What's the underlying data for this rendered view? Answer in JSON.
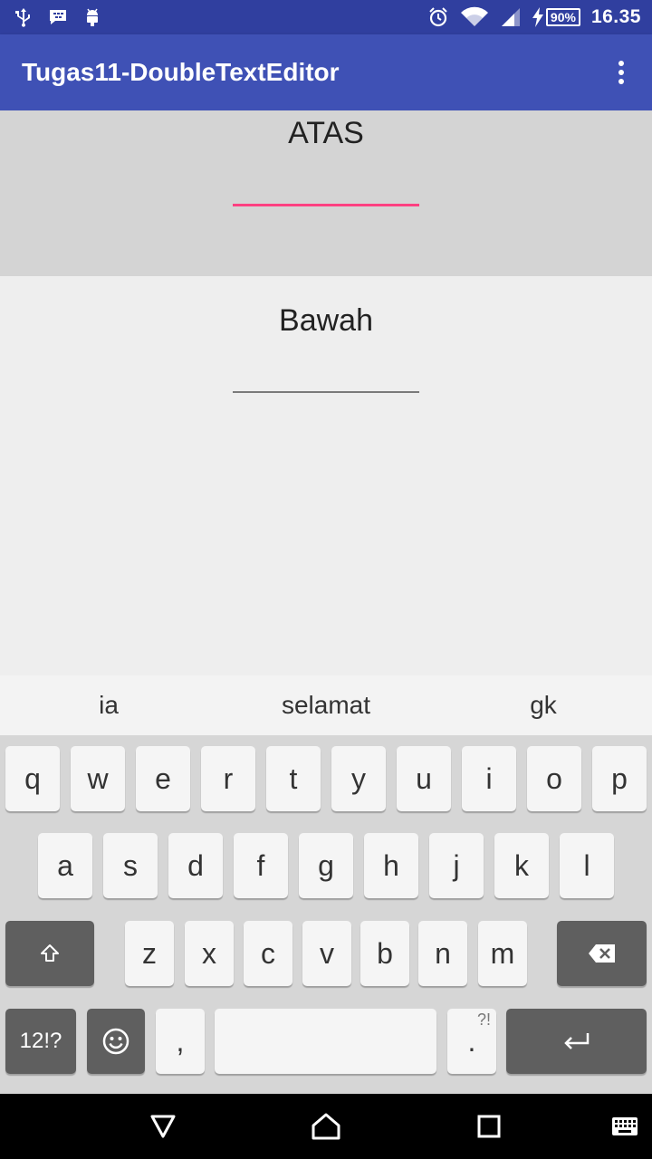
{
  "status_bar": {
    "icons": [
      "usb-icon",
      "bbm-icon",
      "android-debug-icon",
      "alarm-icon",
      "wifi-icon",
      "signal-icon",
      "charging-icon"
    ],
    "battery": "90%",
    "time": "16.35"
  },
  "app_bar": {
    "title": "Tugas11-DoubleTextEditor",
    "overflow_icon": "more-vert-icon"
  },
  "panels": {
    "top": {
      "label": "ATAS",
      "value": "",
      "accent": "#ff4081"
    },
    "bottom": {
      "label": "Bawah",
      "value": ""
    }
  },
  "suggestions": [
    "ia",
    "selamat",
    "gk"
  ],
  "keyboard": {
    "row1": [
      "q",
      "w",
      "e",
      "r",
      "t",
      "y",
      "u",
      "i",
      "o",
      "p"
    ],
    "row2": [
      "a",
      "s",
      "d",
      "f",
      "g",
      "h",
      "j",
      "k",
      "l"
    ],
    "row3": [
      "z",
      "x",
      "c",
      "v",
      "b",
      "n",
      "m"
    ],
    "symbols_label": "12!?",
    "comma_label": ",",
    "period_label": ".",
    "period_hint": "?!",
    "space_label": ""
  },
  "nav_bar": {
    "icons": [
      "back-icon",
      "home-icon",
      "recents-icon",
      "keyboard-switch-icon"
    ]
  },
  "colors": {
    "status_bar": "#303f9f",
    "app_bar": "#3f51b5",
    "accent": "#ff4081"
  }
}
